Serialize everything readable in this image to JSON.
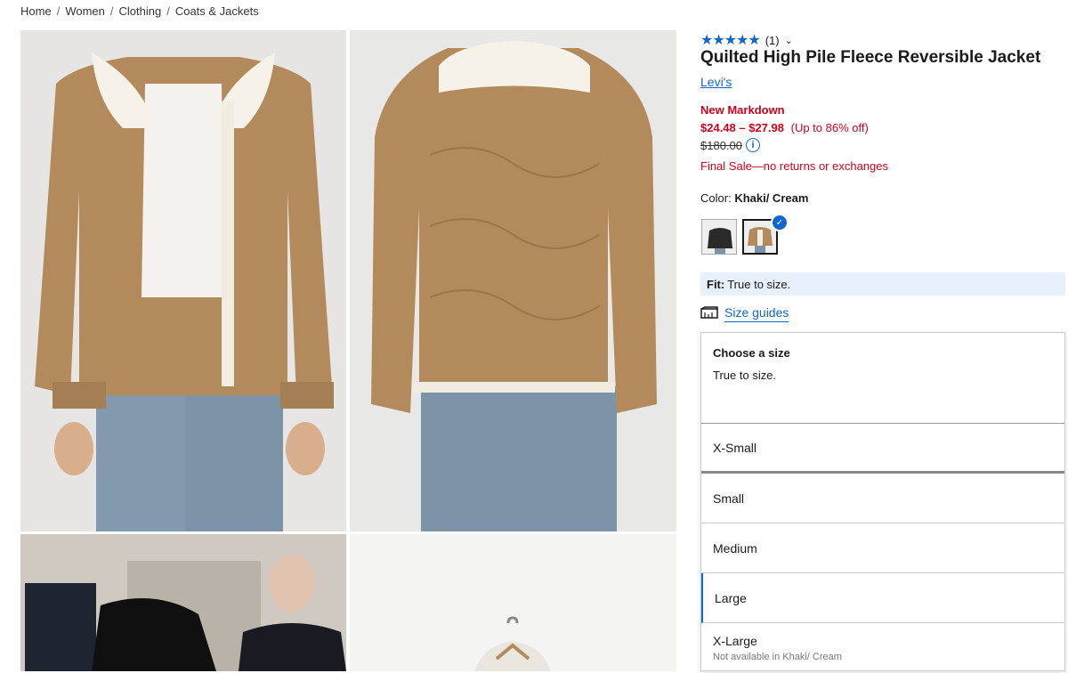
{
  "breadcrumb": [
    "Home",
    "Women",
    "Clothing",
    "Coats & Jackets"
  ],
  "breadcrumb_sep": "/",
  "product": {
    "rating_count": "(1)",
    "title": "Quilted High Pile Fleece Reversible Jacket",
    "brand": "Levi's",
    "markdown_label": "New Markdown",
    "price_range": "$24.48 – $27.98",
    "discount": "(Up to 86% off)",
    "original_price": "$180.00",
    "final_sale": "Final Sale—no returns or exchanges",
    "color_label": "Color:",
    "color_value": "Khaki/ Cream",
    "fit_label": "Fit:",
    "fit_value": "True to size.",
    "size_guides": "Size guides"
  },
  "size_dropdown": {
    "heading": "Choose a size",
    "subheading": "True to size.",
    "options": [
      {
        "label": "X-Small",
        "note": ""
      },
      {
        "label": "Small",
        "note": ""
      },
      {
        "label": "Medium",
        "note": ""
      },
      {
        "label": "Large",
        "note": ""
      },
      {
        "label": "X-Large",
        "note": "Not available in Khaki/ Cream"
      }
    ]
  },
  "colors": {
    "accent": "#1266c9",
    "sale": "#d0021b",
    "jacket": "#b38a5c"
  }
}
